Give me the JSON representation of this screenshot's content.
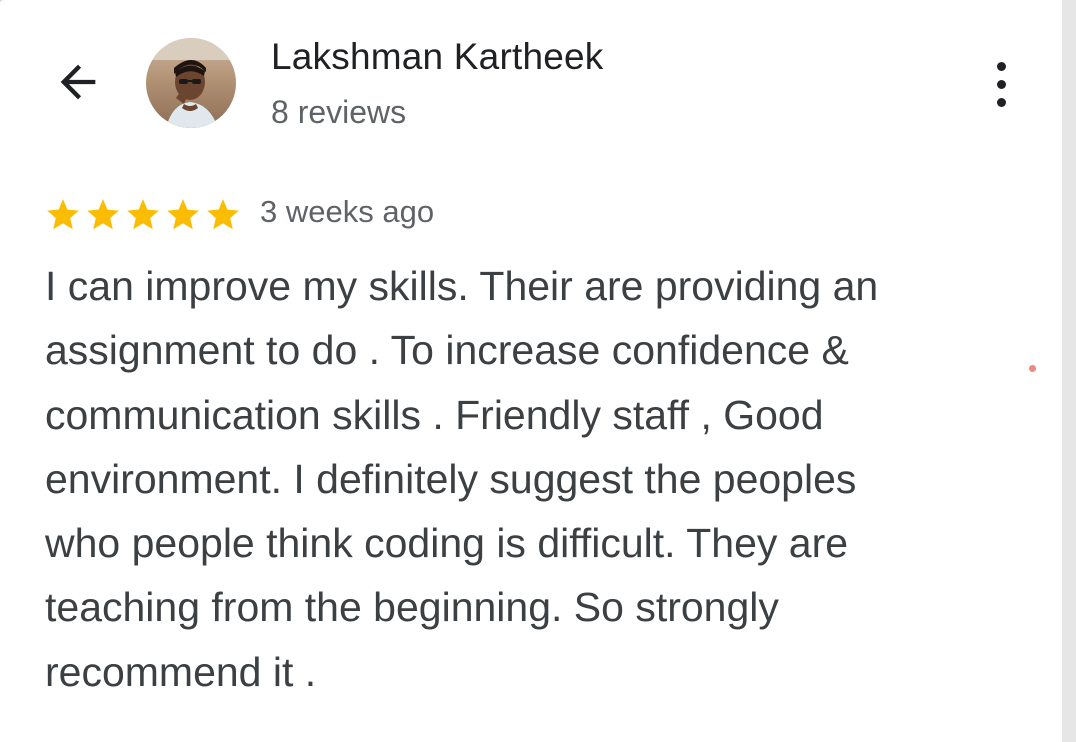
{
  "header": {
    "back_icon": "arrow-back-icon",
    "more_icon": "more-vert-icon"
  },
  "author": {
    "name": "Lakshman Kartheek",
    "review_count": "8 reviews"
  },
  "review": {
    "rating": 5,
    "rating_max": 5,
    "star_color": "#fbbc04",
    "time_ago": "3 weeks ago",
    "text_lines": [
      "I can improve my skills. Their are providing an",
      "assignment to do . To increase confidence &",
      "communication skills . Friendly staff , Good",
      "environment. I definitely suggest the peoples",
      "who people think coding is difficult. They are",
      "teaching from the beginning. So strongly",
      "recommend it ."
    ]
  }
}
